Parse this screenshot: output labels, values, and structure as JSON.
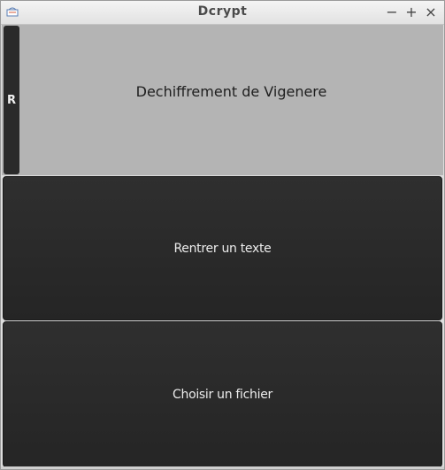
{
  "window": {
    "title": "Dcrypt",
    "controls": {
      "minimize": "−",
      "maximize": "+",
      "close": "×"
    }
  },
  "header": {
    "return_label": "R",
    "title": "Dechiffrement de Vigenere"
  },
  "main": {
    "enter_text_label": "Rentrer un texte",
    "choose_file_label": "Choisir un fichier"
  }
}
